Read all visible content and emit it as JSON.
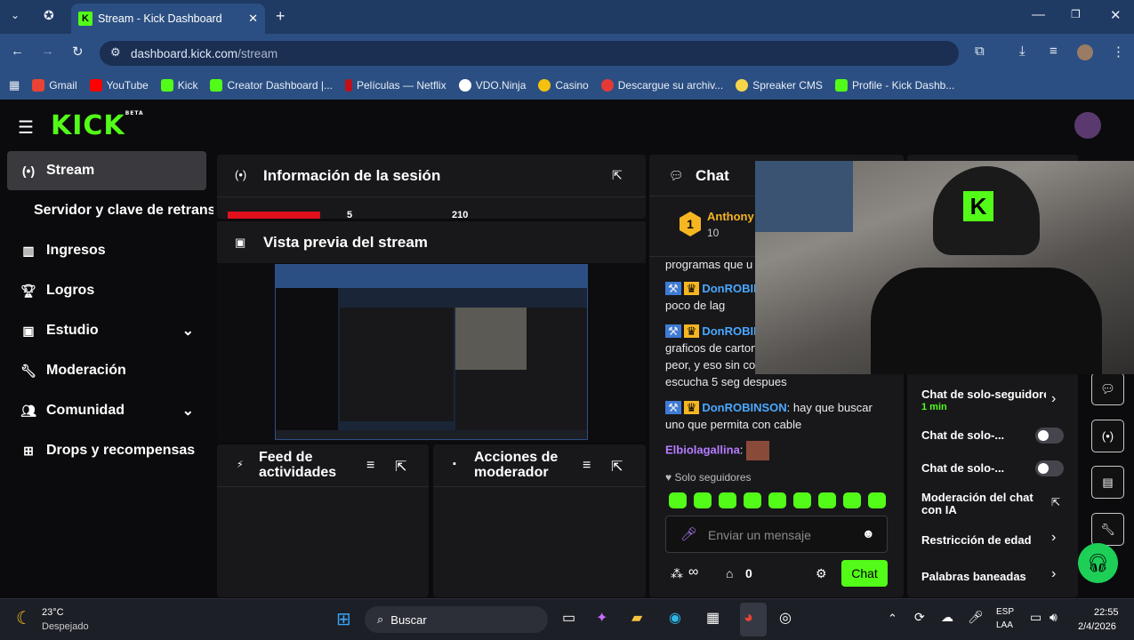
{
  "browser": {
    "tab_title": "Stream - Kick Dashboard",
    "url_domain": "dashboard.kick.com",
    "url_path": "/stream",
    "bookmarks": [
      "Gmail",
      "YouTube",
      "Kick",
      "Creator Dashboard |...",
      "Películas — Netflix",
      "VDO.Ninja",
      "Casino",
      "Descargue su archiv...",
      "Spreaker CMS",
      "Profile - Kick Dashb..."
    ]
  },
  "logo": {
    "text": "KICK",
    "badge": "BETA"
  },
  "sidebar": {
    "items": [
      "Stream",
      "Servidor y clave de retransm",
      "Ingresos",
      "Logros",
      "Estudio",
      "Moderación",
      "Comunidad",
      "Drops y recompensas"
    ]
  },
  "session": {
    "title": "Información de la sesión",
    "stat1": "5",
    "stat2": "210"
  },
  "preview": {
    "title": "Vista previa del stream"
  },
  "feed": {
    "title": "Feed de actividades"
  },
  "modactions": {
    "title": "Acciones de moderador"
  },
  "chat": {
    "title": "Chat",
    "top_user": "Anthony",
    "top_rank": "1",
    "top_count": "10",
    "msgs": [
      {
        "user": "",
        "text": "programas que u"
      },
      {
        "user": "DonROBIN",
        "text": ""
      },
      {
        "user": "",
        "text": "poco de lag"
      },
      {
        "user": "DonROBIN",
        "text": ""
      },
      {
        "user": "",
        "text": "graficos de carton"
      },
      {
        "user": "",
        "text": "peor, y eso sin co"
      },
      {
        "user": "",
        "text": "escucha 5 seg despues"
      },
      {
        "user": "DonROBINSON",
        "text": ": hay que buscar"
      },
      {
        "user": "",
        "text": "uno que permita con cable"
      },
      {
        "user": "Elbiolagallina",
        "text": ":"
      }
    ],
    "followers_only": "Solo seguidores",
    "placeholder": "Enviar un mensaje",
    "infinite": "∞",
    "count": "0",
    "send": "Chat"
  },
  "settings": {
    "r1": "Chat de solo-seguidores",
    "r1_sub": "1 min",
    "r2": "Chat de solo-...",
    "r3": "Chat de solo-...",
    "r4": "Moderación del chat con IA",
    "r5": "Restricción de edad",
    "r6": "Palabras baneadas"
  },
  "taskbar": {
    "temp": "23°C",
    "weather": "Despejado",
    "search": "Buscar",
    "lang1": "ESP",
    "lang2": "LAA",
    "time": "22:55",
    "date": "2/4/2026"
  },
  "colors": {
    "kick_green": "#53fc18",
    "browser_blue": "#2b4f82"
  }
}
